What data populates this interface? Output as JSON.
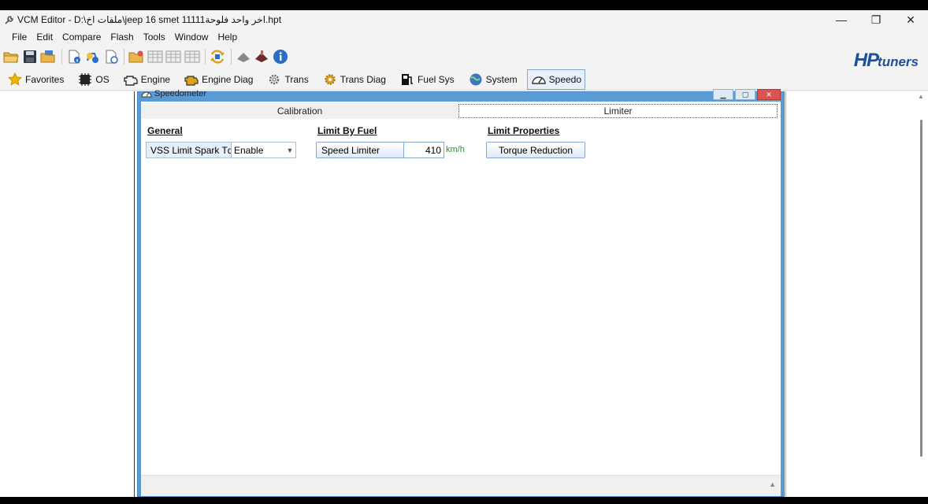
{
  "window": {
    "title": "VCM Editor - D:\\ملفات اخ\\jeep 16 smet 11111اخر واحد فلوحة.hpt",
    "minimize": "—",
    "maximize": "❐",
    "close": "✕"
  },
  "menu": [
    "File",
    "Edit",
    "Compare",
    "Flash",
    "Tools",
    "Window",
    "Help"
  ],
  "toolbar": {
    "icons": [
      "open-folder-icon",
      "save-icon",
      "save-as-icon",
      "file-info-icon",
      "vehicle-info-icon",
      "compare-file-icon",
      "load-folder-icon",
      "table-icon",
      "table-icon",
      "table-icon",
      "swap-icon",
      "write-vehicle-icon",
      "read-vehicle-icon",
      "info-icon"
    ],
    "logo_hp": "HP",
    "logo_tuners": "tuners"
  },
  "nav": [
    {
      "label": "Favorites",
      "icon": "star-icon"
    },
    {
      "label": "OS",
      "icon": "chip-icon"
    },
    {
      "label": "Engine",
      "icon": "engine-icon"
    },
    {
      "label": "Engine Diag",
      "icon": "engine-diag-icon"
    },
    {
      "label": "Trans",
      "icon": "gear-icon"
    },
    {
      "label": "Trans Diag",
      "icon": "trans-diag-icon"
    },
    {
      "label": "Fuel Sys",
      "icon": "fuel-pump-icon"
    },
    {
      "label": "System",
      "icon": "globe-icon"
    },
    {
      "label": "Speedo",
      "icon": "speedometer-icon",
      "active": true
    }
  ],
  "child_window": {
    "title": "Speedometer",
    "tabs": [
      "Calibration",
      "Limiter"
    ],
    "selected_tab": "Limiter",
    "sections": {
      "general": "General",
      "limit_by_fuel": "Limit By Fuel",
      "limit_properties": "Limit Properties"
    },
    "vss_limit": {
      "label": "VSS Limit Spark TqMgt",
      "value": "Enable"
    },
    "speed_limiter": {
      "label": "Speed Limiter",
      "value": "410",
      "unit": "km/h"
    },
    "torque_reduction": "Torque Reduction"
  }
}
